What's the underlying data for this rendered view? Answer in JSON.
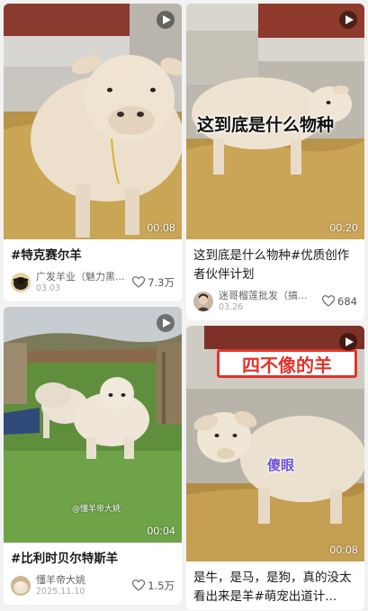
{
  "feed": {
    "cards": [
      {
        "id": "c1",
        "title": "#特克赛尔羊",
        "author": "广发羊业（魅力黑...",
        "date": "03.03",
        "likes": "7.3万",
        "duration": "00:08"
      },
      {
        "id": "c2",
        "overlay": "这到底是什么物种",
        "title": "这到底是什么物种#优质创作者伙伴计划",
        "author": "迷哥榴莲批发（搞...",
        "date": "03.26",
        "likes": "684",
        "duration": "00:20"
      },
      {
        "id": "c3",
        "watermark": "@懂羊帝大姚",
        "title": "#比利时贝尔特斯羊",
        "author": "懂羊帝大姚",
        "date": "2025.11.10",
        "likes": "1.5万",
        "duration": "00:04"
      },
      {
        "id": "c4",
        "overlay_banner": "四不像的羊",
        "overlay_sub": "傻眼",
        "title": "是牛，是马，是狗，真的没太看出来是羊#萌宠出道计...",
        "duration": "00:08"
      }
    ]
  },
  "colors": {
    "banner_red": "#e0352b",
    "background": "#f2f2f2",
    "card": "#ffffff"
  }
}
